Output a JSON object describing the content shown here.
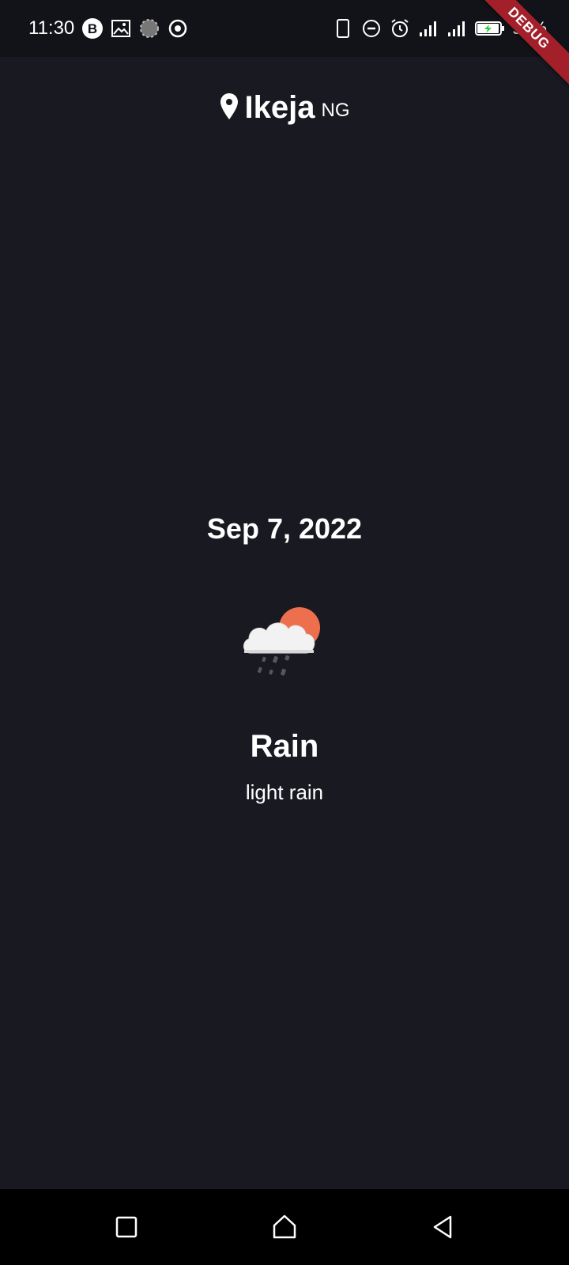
{
  "status_bar": {
    "time": "11:30",
    "battery_text": "91%",
    "left_icons": [
      "bitcoin-icon",
      "gallery-icon",
      "loading-icon",
      "record-icon"
    ],
    "right_icons": [
      "phone-icon",
      "dnd-icon",
      "alarm-icon",
      "signal-icon",
      "signal-icon-2",
      "battery-charging-icon"
    ]
  },
  "debug_banner": {
    "label": "DEBUG",
    "color": "#a3202a"
  },
  "location": {
    "city": "Ikeja",
    "country": "NG",
    "icon": "location-pin-icon"
  },
  "weather": {
    "date": "Sep 7, 2022",
    "condition": "Rain",
    "description": "light rain",
    "icon": "cloud-sun-rain-icon"
  },
  "colors": {
    "background": "#191a21",
    "status_bar": "#121318",
    "sun": "#ee6f4e",
    "cloud": "#f2f2f2",
    "text": "#ffffff"
  },
  "nav_bar": {
    "buttons": [
      "recents-icon",
      "home-icon",
      "back-icon"
    ]
  }
}
